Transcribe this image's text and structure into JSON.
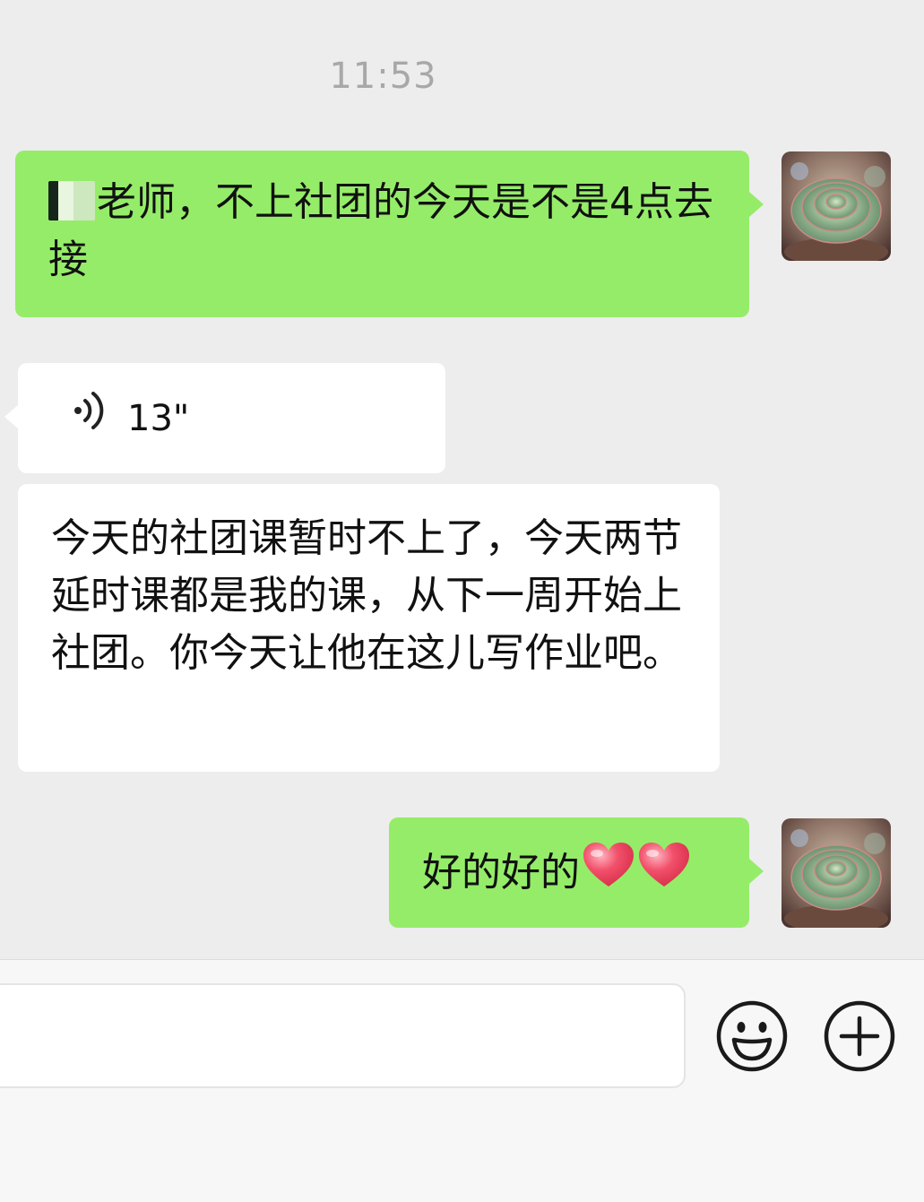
{
  "chat": {
    "timestamp": "11:53",
    "messages": [
      {
        "side": "outgoing",
        "type": "text",
        "text": "老师，不上社团的今天是不是4点去接"
      },
      {
        "side": "incoming",
        "type": "voice",
        "duration": "13\""
      },
      {
        "side": "incoming",
        "type": "text",
        "text": "今天的社团课暂时不上了，今天两节延时课都是我的课，从下一周开始上社团。你今天让他在这儿写作业吧。"
      },
      {
        "side": "outgoing",
        "type": "text",
        "text": "好的好的",
        "emoji": [
          "heart",
          "heart"
        ]
      }
    ]
  },
  "input_bar": {
    "value": "",
    "emoji_icon": "smiley-face-icon",
    "more_icon": "plus-circle-icon"
  },
  "colors": {
    "outgoing_bubble": "#95ec69",
    "incoming_bubble": "#ffffff",
    "background": "#ededed",
    "heart": "#f2506a"
  }
}
